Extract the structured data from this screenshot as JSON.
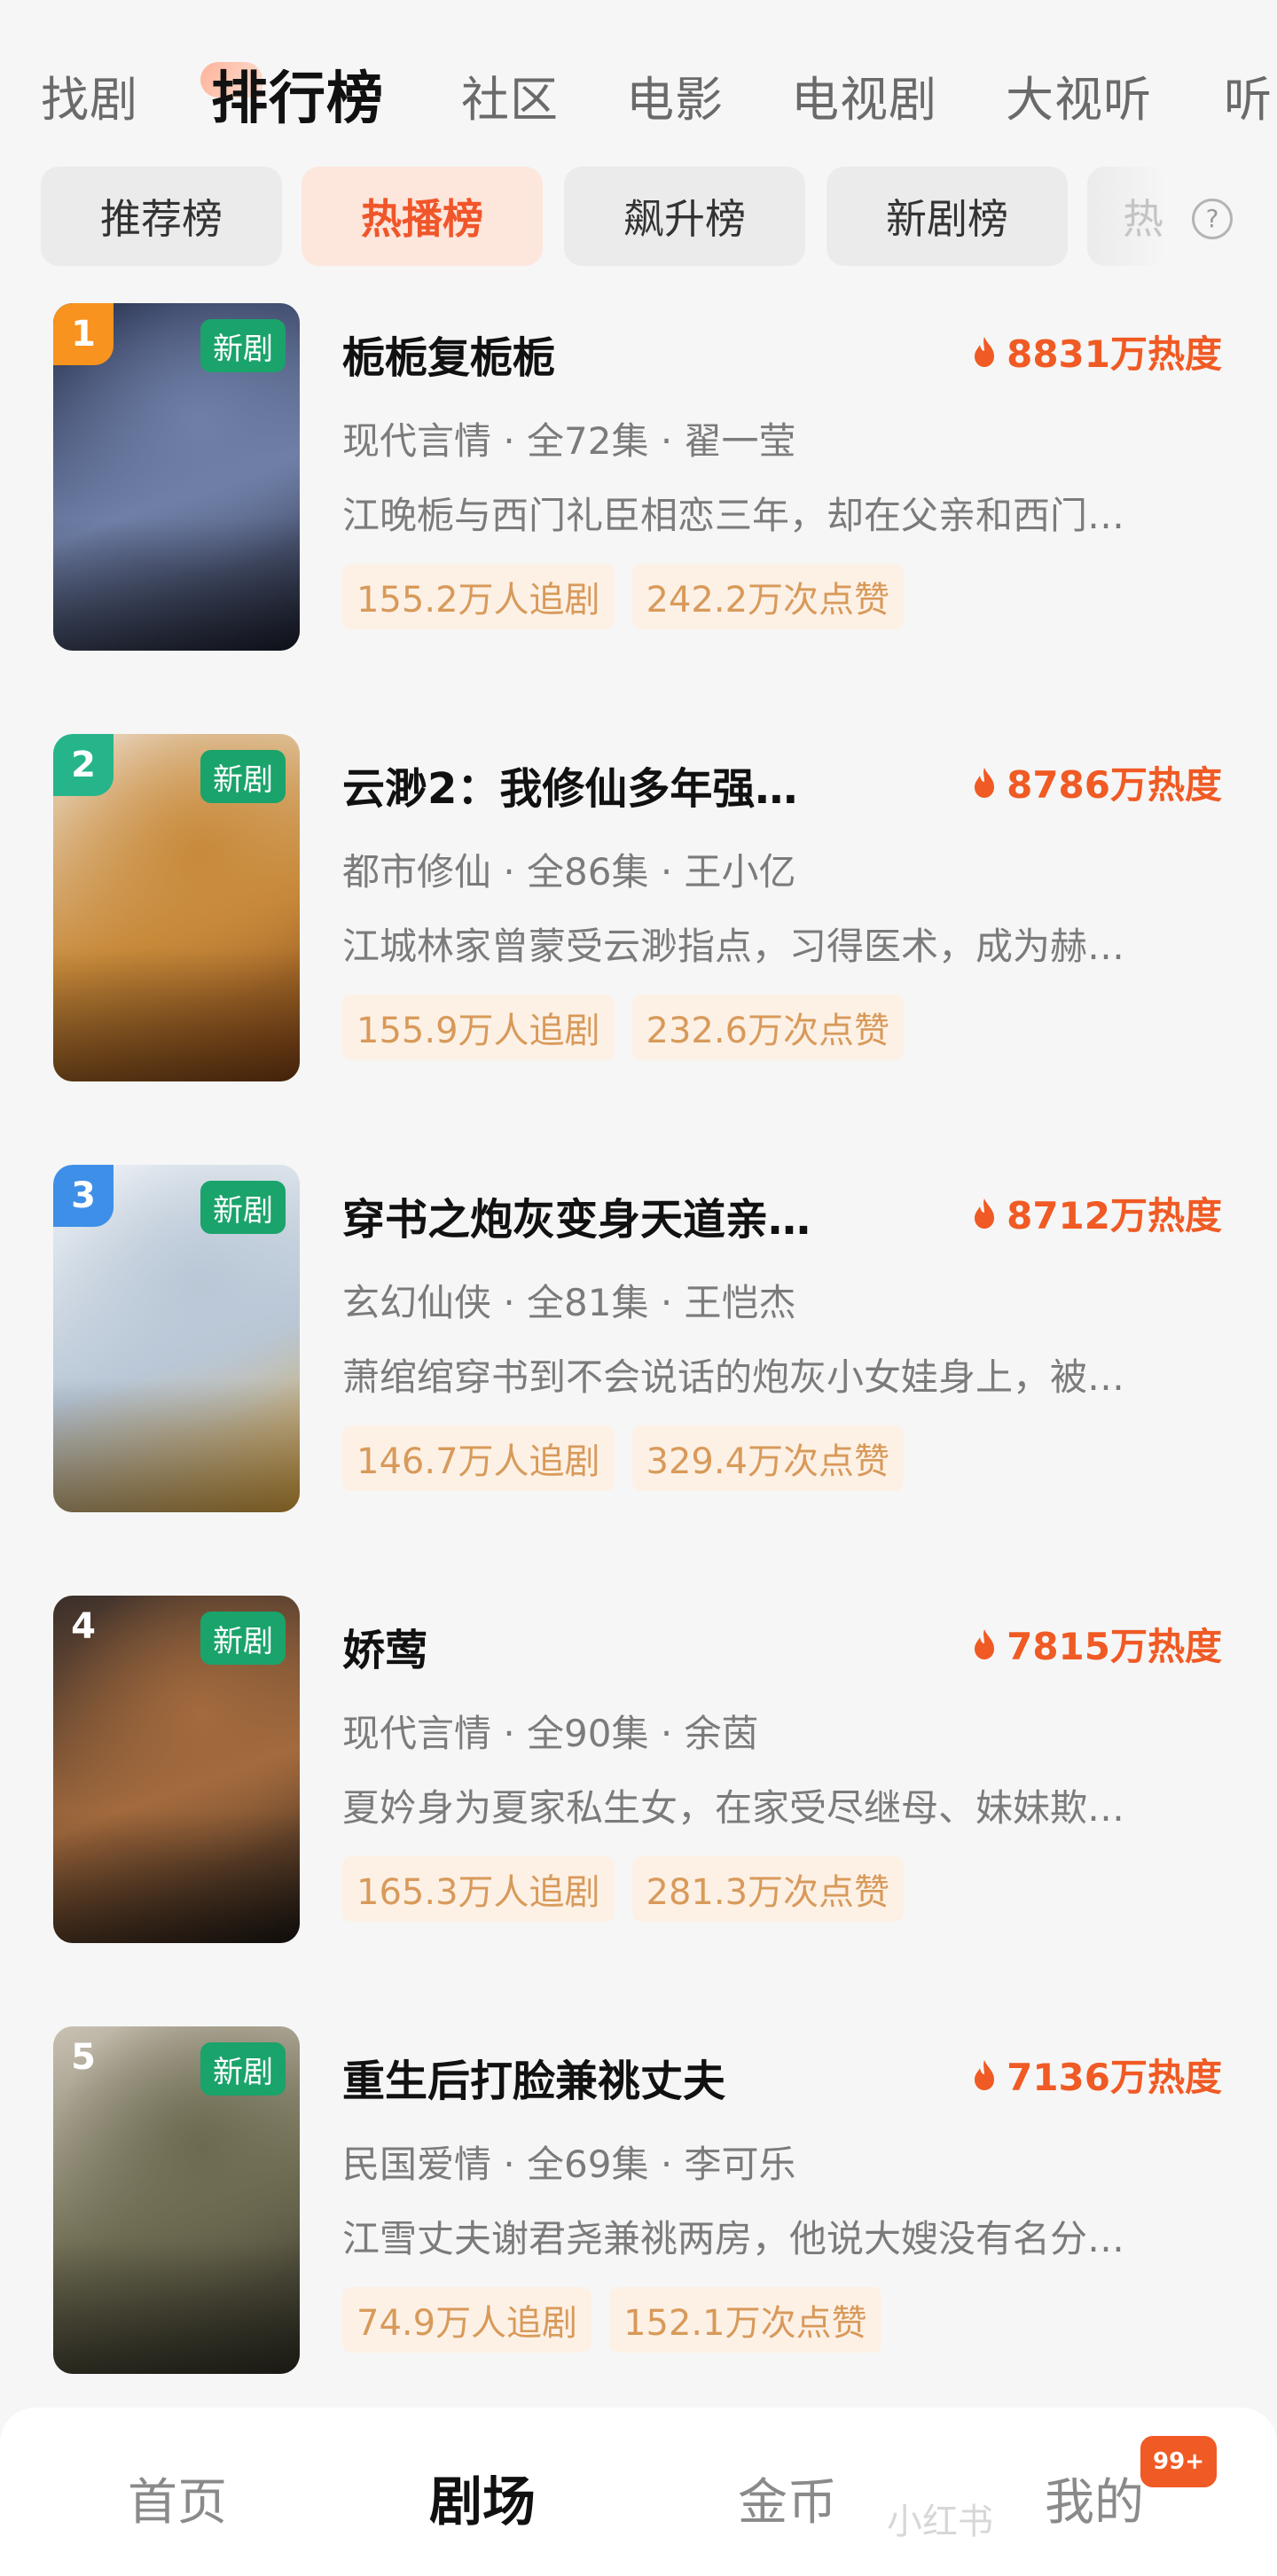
{
  "top_tabs": [
    "找剧",
    "排行榜",
    "社区",
    "电影",
    "电视剧",
    "大视听",
    "听"
  ],
  "active_top_tab_index": 1,
  "chips": [
    "推荐榜",
    "热播榜",
    "飙升榜",
    "新剧榜",
    "热"
  ],
  "active_chip_index": 1,
  "help_icon": "?",
  "items": [
    {
      "rank": "1",
      "rank_color": "#f7931e",
      "badge": "新剧",
      "title": "栀栀复栀栀",
      "heat": "8831万热度",
      "meta": "现代言情 · 全72集 · 翟一莹",
      "desc": "江晚栀与西门礼臣相恋三年，却在父亲和西门…",
      "follow": "155.2万人追剧",
      "likes": "242.2万次点赞",
      "poster_colors": [
        "#2b3552",
        "#6f7fa7",
        "#1a1d2b"
      ]
    },
    {
      "rank": "2",
      "rank_color": "#26b58a",
      "badge": "新剧",
      "title": "云渺2：我修仙多年强…",
      "heat": "8786万热度",
      "meta": "都市修仙 · 全86集 · 王小亿",
      "desc": "江城林家曾蒙受云渺指点，习得医术，成为赫…",
      "follow": "155.9万人追剧",
      "likes": "232.6万次点赞",
      "poster_colors": [
        "#e9d7c1",
        "#c88a3a",
        "#7a3e12"
      ]
    },
    {
      "rank": "3",
      "rank_color": "#3d8fe8",
      "badge": "新剧",
      "title": "穿书之炮灰变身天道亲…",
      "heat": "8712万热度",
      "meta": "玄幻仙侠 · 全81集 · 王恺杰",
      "desc": "萧绾绾穿书到不会说话的炮灰小女娃身上，被…",
      "follow": "146.7万人追剧",
      "likes": "329.4万次点赞",
      "poster_colors": [
        "#eef2f6",
        "#b9c7d6",
        "#d9a13a"
      ]
    },
    {
      "rank": "4",
      "rank_color": "rgba(0,0,0,0)",
      "badge": "新剧",
      "title": "娇莺",
      "heat": "7815万热度",
      "meta": "现代言情 · 全90集 · 余茵",
      "desc": "夏妗身为夏家私生女，在家受尽继母、妹妹欺…",
      "follow": "165.3万人追剧",
      "likes": "281.3万次点赞",
      "poster_colors": [
        "#3a2f2a",
        "#a36a3d",
        "#1b1714"
      ]
    },
    {
      "rank": "5",
      "rank_color": "rgba(0,0,0,0)",
      "badge": "新剧",
      "title": "重生后打脸兼祧丈夫",
      "heat": "7136万热度",
      "meta": "民国爱情 · 全69集 · 李可乐",
      "desc": "江雪丈夫谢君尧兼祧两房，他说大嫂没有名分…",
      "follow": "74.9万人追剧",
      "likes": "152.1万次点赞",
      "poster_colors": [
        "#c9c1b3",
        "#6c6a50",
        "#2e2c22"
      ]
    }
  ],
  "bottom_nav": [
    "首页",
    "剧场",
    "金币",
    "我的"
  ],
  "active_bottom_index": 1,
  "coin_badge": "99+",
  "watermark": "小红书"
}
